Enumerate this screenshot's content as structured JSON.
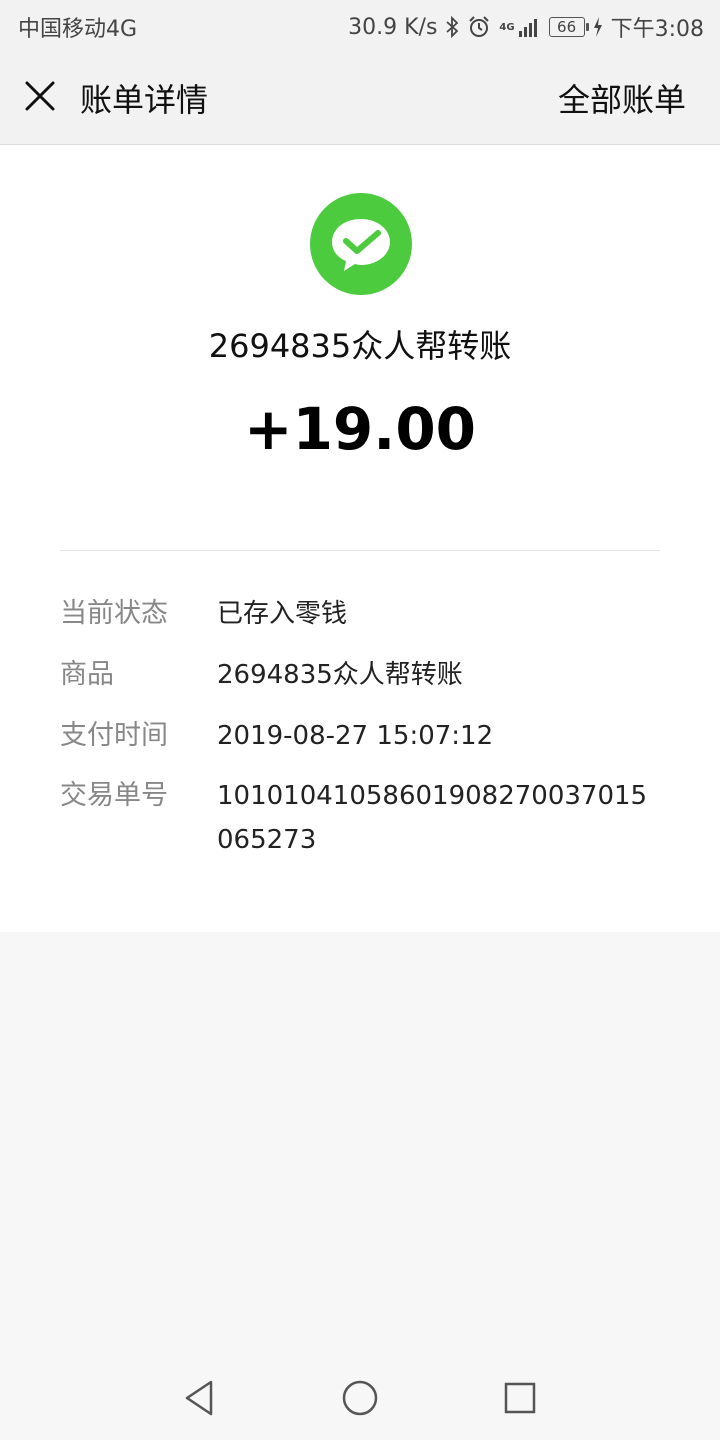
{
  "status_bar": {
    "carrier": "中国移动4G",
    "network_speed": "30.9 K/s",
    "signal_label": "4G",
    "battery": "66",
    "time": "下午3:08",
    "icons": [
      "bluetooth-icon",
      "alarm-icon",
      "signal-icon",
      "battery-icon",
      "charging-icon"
    ]
  },
  "header": {
    "title": "账单详情",
    "all_bills": "全部账单",
    "close_icon": "close-icon"
  },
  "transaction": {
    "logo_icon": "wechat-pay-icon",
    "logo_color": "#4ccb3f",
    "merchant": "2694835众人帮转账",
    "amount": "+19.00"
  },
  "details": [
    {
      "label": "当前状态",
      "value": "已存入零钱"
    },
    {
      "label": "商品",
      "value": "2694835众人帮转账"
    },
    {
      "label": "支付时间",
      "value": "2019-08-27 15:07:12"
    },
    {
      "label": "交易单号",
      "value": "10101041058601908270037015065273"
    }
  ],
  "nav_bar": {
    "icons": [
      "back-icon",
      "home-icon",
      "recents-icon"
    ]
  }
}
